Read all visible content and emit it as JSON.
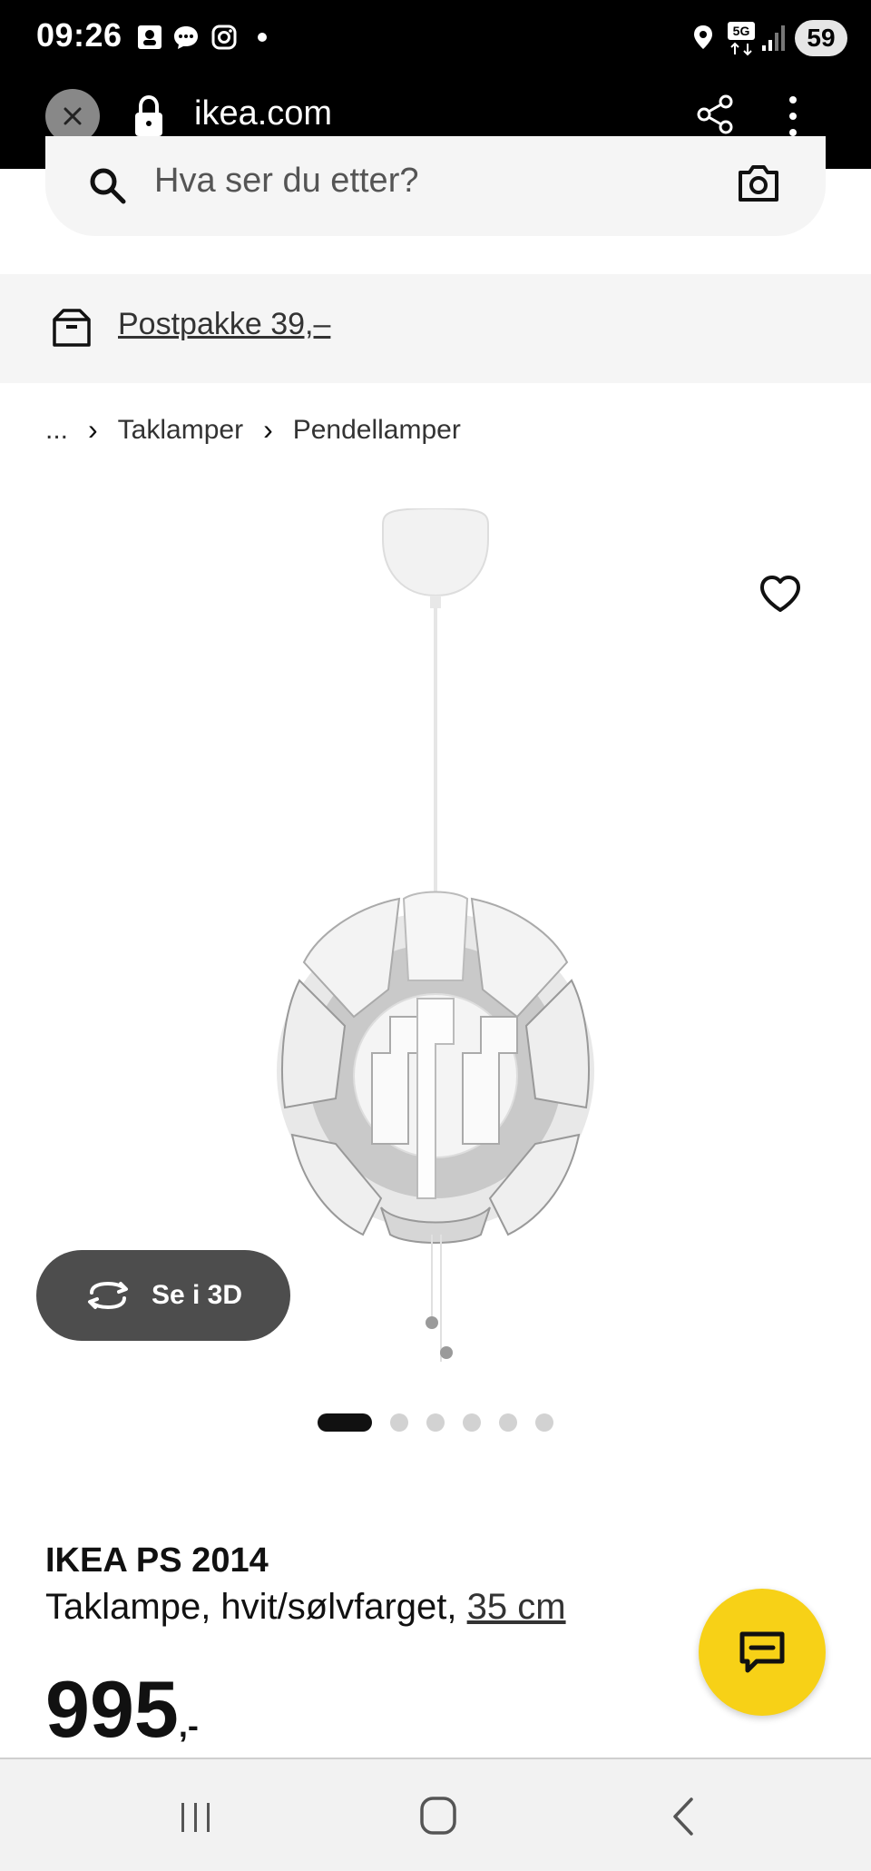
{
  "status_bar": {
    "time": "09:26",
    "battery": "59",
    "icons": [
      "contact-icon",
      "message-icon",
      "instagram-icon",
      "notification-dot",
      "location-icon",
      "5g-icon",
      "signal-icon",
      "battery-icon"
    ]
  },
  "browser": {
    "url": "ikea.com",
    "icons": [
      "close-icon",
      "lock-icon",
      "share-icon",
      "more-vert-icon"
    ]
  },
  "search": {
    "placeholder": "Hva ser du etter?",
    "icons": [
      "search-icon",
      "camera-icon"
    ]
  },
  "shipping": {
    "label": "Postpakke 39,–",
    "icon": "package-icon"
  },
  "breadcrumb": {
    "ellipsis": "...",
    "items": [
      "Taklamper",
      "Pendellamper"
    ]
  },
  "gallery": {
    "view_3d_label": "Se i 3D",
    "page_count": 6,
    "active_page": 1,
    "favorite_icon": "heart-icon"
  },
  "product": {
    "name": "IKEA PS 2014",
    "description": "Taklampe, hvit/sølvfarget,",
    "size": "35 cm",
    "price_main": "995",
    "price_suffix": ",-"
  },
  "chat": {
    "icon": "chat-icon",
    "color": "#F7D117"
  },
  "nav": {
    "icons": [
      "recent-apps-icon",
      "home-icon",
      "back-icon"
    ]
  }
}
